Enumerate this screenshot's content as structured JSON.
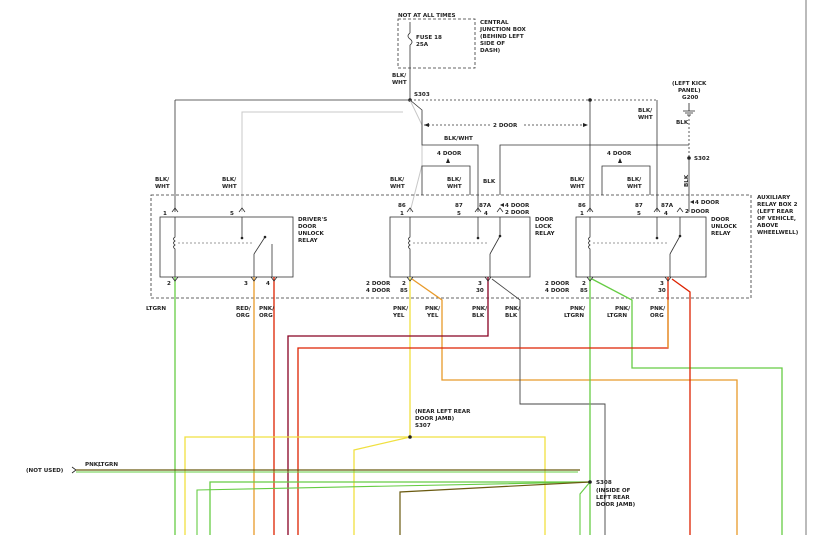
{
  "colors": {
    "wire_green": "#66cc44",
    "wire_orange": "#e89a2a",
    "wire_red": "#dd2200",
    "wire_yellow": "#f0e040",
    "wire_darkred": "#880022",
    "wire_gray": "#444444",
    "wire_light": "#c8c8c8",
    "wire_olive": "#6a5a10",
    "line": "#333333"
  },
  "top": {
    "not_at_all_times": "NOT AT ALL TIMES",
    "fuse_name": "FUSE 18",
    "fuse_rating": "25A",
    "cjb_1": "CENTRAL",
    "cjb_2": "JUNCTION BOX",
    "cjb_3": "(BEHIND LEFT",
    "cjb_4": "SIDE OF",
    "cjb_5": "DASH)",
    "feed_wire_1": "BLK/",
    "feed_wire_2": "WHT",
    "s303": "S303",
    "kick_1": "(LEFT KICK",
    "kick_2": "PANEL)",
    "g200": "G200",
    "ground_wire": "BLK",
    "two_door": "2 DOOR",
    "s302": "S302"
  },
  "wires": {
    "blk_wht_1": "BLK/",
    "blk_wht_2": "WHT",
    "blk_wht_combined": "BLK/WHT",
    "blk": "BLK",
    "four_door": "4 DOOR",
    "four_door_l": "4 DOOR",
    "two_door_l": "2 DOOR",
    "pnk_ltgrn_1": "PNK/",
    "pnk_ltgrn_2": "LTGRN",
    "pnk_org_1": "PNK/",
    "pnk_org_2": "ORG",
    "red_org_1": "RED/",
    "red_org_2": "ORG",
    "pnk_yel_1": "PNK/",
    "pnk_yel_2": "YEL",
    "pnk_blk_1": "PNK/",
    "pnk_blk_2": "BLK",
    "ltgrn": "LTGRN"
  },
  "relays": {
    "driver_1": "DRIVER'S",
    "driver_2": "DOOR",
    "driver_3": "UNLOCK",
    "driver_4": "RELAY",
    "lock_1": "DOOR",
    "lock_2": "LOCK",
    "lock_3": "RELAY",
    "unlock_1": "DOOR",
    "unlock_2": "UNLOCK",
    "unlock_3": "RELAY"
  },
  "pins": {
    "p1": "1",
    "p2": "2",
    "p3": "3",
    "p4": "4",
    "p5": "5",
    "p30": "30",
    "p85": "85",
    "p86": "86",
    "p87": "87",
    "p87a": "87A"
  },
  "aux_box": {
    "l1": "AUXILIARY",
    "l2": "RELAY BOX 2",
    "l3": "(LEFT REAR",
    "l4": "OF VEHICLE,",
    "l5": "ABOVE",
    "l6": "WHEELWELL)"
  },
  "bottom": {
    "not_used": "(NOT USED)",
    "near_1": "(NEAR LEFT REAR",
    "near_2": "DOOR JAMB)",
    "s307": "S307",
    "s308": "S308",
    "inside_1": "(INSIDE OF",
    "inside_2": "LEFT REAR",
    "inside_3": "DOOR JAMB)"
  }
}
